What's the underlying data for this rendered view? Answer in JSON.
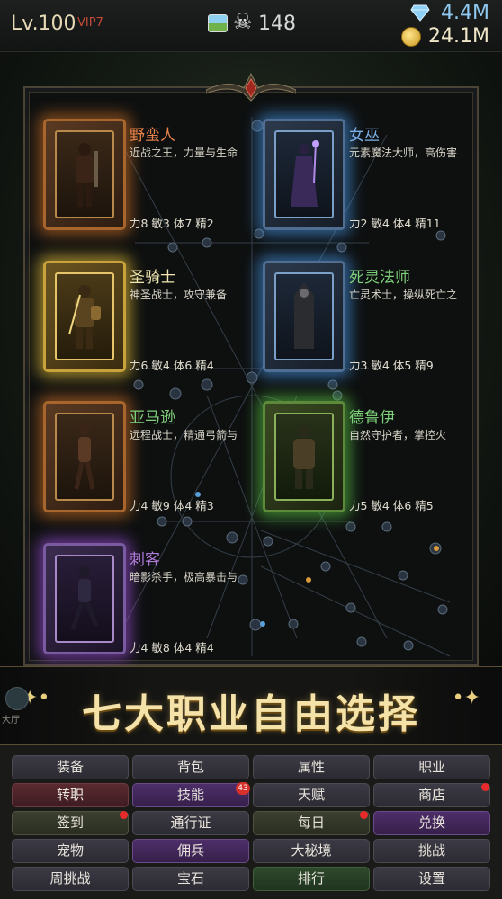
{
  "header": {
    "level": "Lv.100",
    "vip": "VIP7",
    "kills": "148",
    "gems": "4.4M",
    "gold": "24.1M"
  },
  "classes": [
    {
      "name": "野蛮人",
      "desc": "近战之王，力量与生命",
      "stats": "力8 敏3 体7 精2",
      "glow": "orange"
    },
    {
      "name": "女巫",
      "desc": "元素魔法大师，高伤害",
      "stats": "力2 敏4 体4 精11",
      "glow": "blue"
    },
    {
      "name": "圣骑士",
      "desc": "神圣战士，攻守兼备",
      "stats": "力6 敏4 体6 精4",
      "glow": "gold"
    },
    {
      "name": "死灵法师",
      "desc": "亡灵术士，操纵死亡之",
      "stats": "力3 敏4 体5 精9",
      "glow": "blue"
    },
    {
      "name": "亚马逊",
      "desc": "远程战士，精通弓箭与",
      "stats": "力4 敏9 体4 精3",
      "glow": "orange"
    },
    {
      "name": "德鲁伊",
      "desc": "自然守护者，掌控火",
      "stats": "力5 敏4 体6 精5",
      "glow": "green"
    },
    {
      "name": "刺客",
      "desc": "暗影杀手，极高暴击与",
      "stats": "力4 敏8 体4 精4",
      "glow": "purple"
    }
  ],
  "banner": {
    "title": "七大职业自由选择",
    "side_label": "大厅"
  },
  "menu": [
    {
      "label": "装备",
      "color": "gray"
    },
    {
      "label": "背包",
      "color": "gray"
    },
    {
      "label": "属性",
      "color": "gray"
    },
    {
      "label": "职业",
      "color": "gray"
    },
    {
      "label": "转职",
      "color": "red"
    },
    {
      "label": "技能",
      "color": "purple",
      "badge": "43"
    },
    {
      "label": "天赋",
      "color": "gray"
    },
    {
      "label": "商店",
      "color": "gray",
      "dot": true
    },
    {
      "label": "签到",
      "color": "olive",
      "dot": true
    },
    {
      "label": "通行证",
      "color": "gray"
    },
    {
      "label": "每日",
      "color": "olive",
      "dot": true
    },
    {
      "label": "兑换",
      "color": "purple"
    },
    {
      "label": "宠物",
      "color": "gray"
    },
    {
      "label": "佣兵",
      "color": "purple"
    },
    {
      "label": "大秘境",
      "color": "gray"
    },
    {
      "label": "挑战",
      "color": "gray"
    },
    {
      "label": "周挑战",
      "color": "gray"
    },
    {
      "label": "宝石",
      "color": "gray"
    },
    {
      "label": "排行",
      "color": "green"
    },
    {
      "label": "设置",
      "color": "gray"
    }
  ],
  "colors": {
    "gem": "#8fc8f0",
    "gold_text": "#f0e6c8",
    "banner_text": "#f4e2a8"
  }
}
